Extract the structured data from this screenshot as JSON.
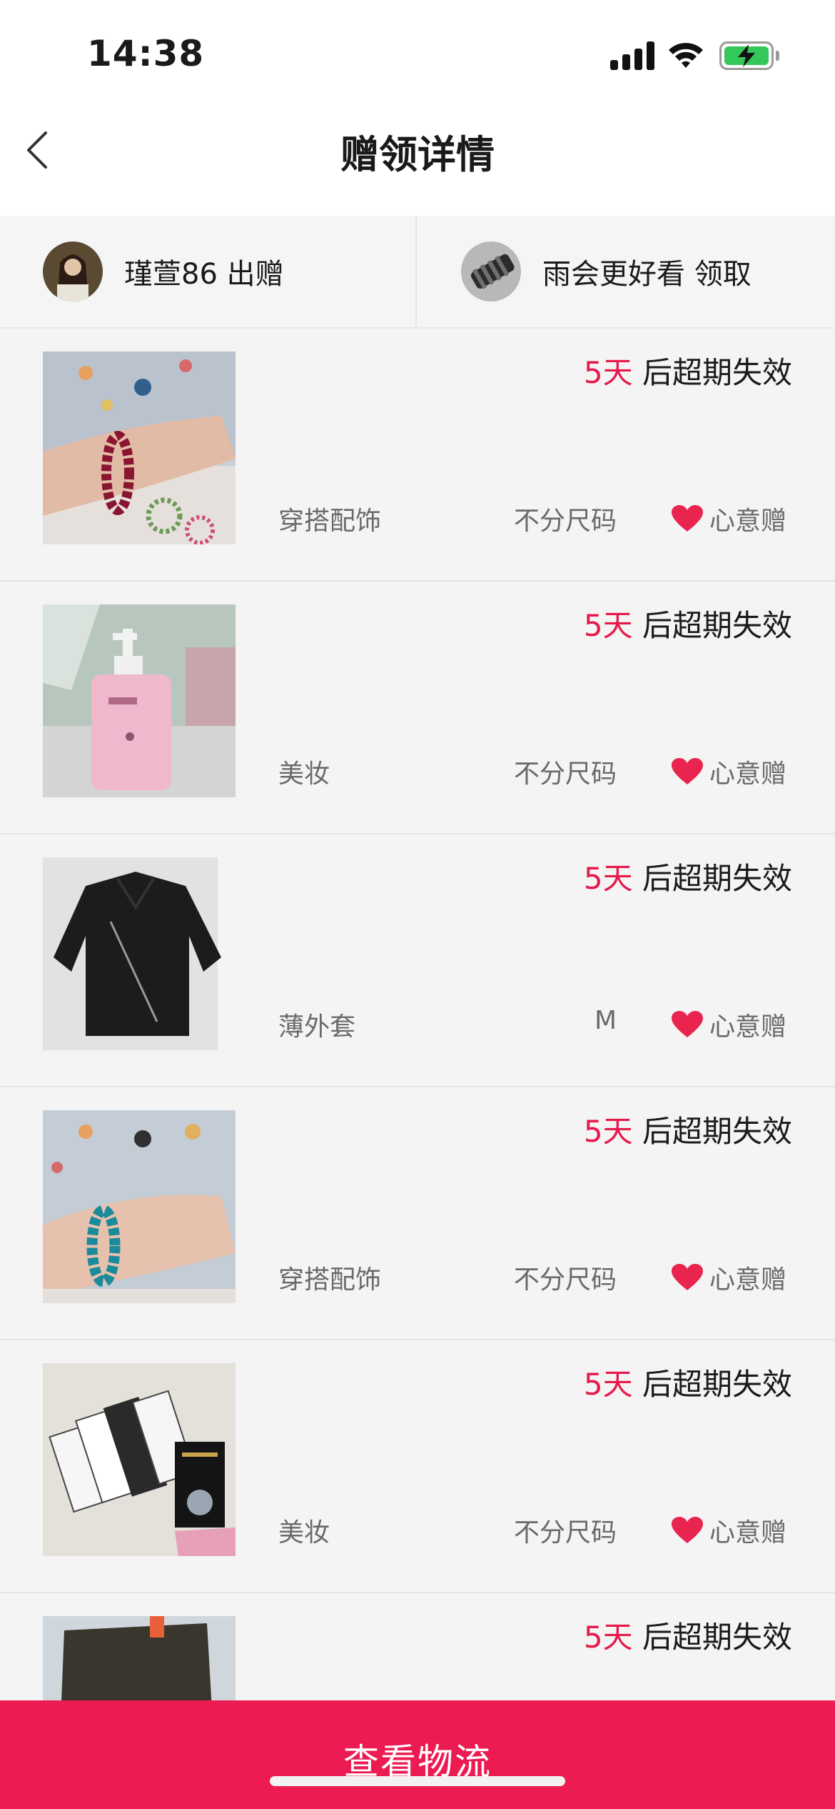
{
  "status_bar": {
    "time": "14:38"
  },
  "nav": {
    "title": "赠领详情"
  },
  "users": {
    "giver": "瑾萱86 出赠",
    "receiver": "雨会更好看 领取"
  },
  "items": [
    {
      "days": "5天",
      "expire_suffix": " 后超期失效",
      "category": "穿搭配饰",
      "size": "不分尺码",
      "gift_type": "心意赠"
    },
    {
      "days": "5天",
      "expire_suffix": " 后超期失效",
      "category": "美妆",
      "size": "不分尺码",
      "gift_type": "心意赠"
    },
    {
      "days": "5天",
      "expire_suffix": " 后超期失效",
      "category": "薄外套",
      "size": "M",
      "gift_type": "心意赠"
    },
    {
      "days": "5天",
      "expire_suffix": " 后超期失效",
      "category": "穿搭配饰",
      "size": "不分尺码",
      "gift_type": "心意赠"
    },
    {
      "days": "5天",
      "expire_suffix": " 后超期失效",
      "category": "美妆",
      "size": "不分尺码",
      "gift_type": "心意赠"
    },
    {
      "days": "5天",
      "expire_suffix": " 后超期失效",
      "category": "",
      "size": "",
      "gift_type": ""
    }
  ],
  "footer": {
    "button_label": "查看物流"
  },
  "colors": {
    "accent": "#e6194b",
    "footer_bg": "#ec1b52",
    "heart": "#e8244f"
  }
}
